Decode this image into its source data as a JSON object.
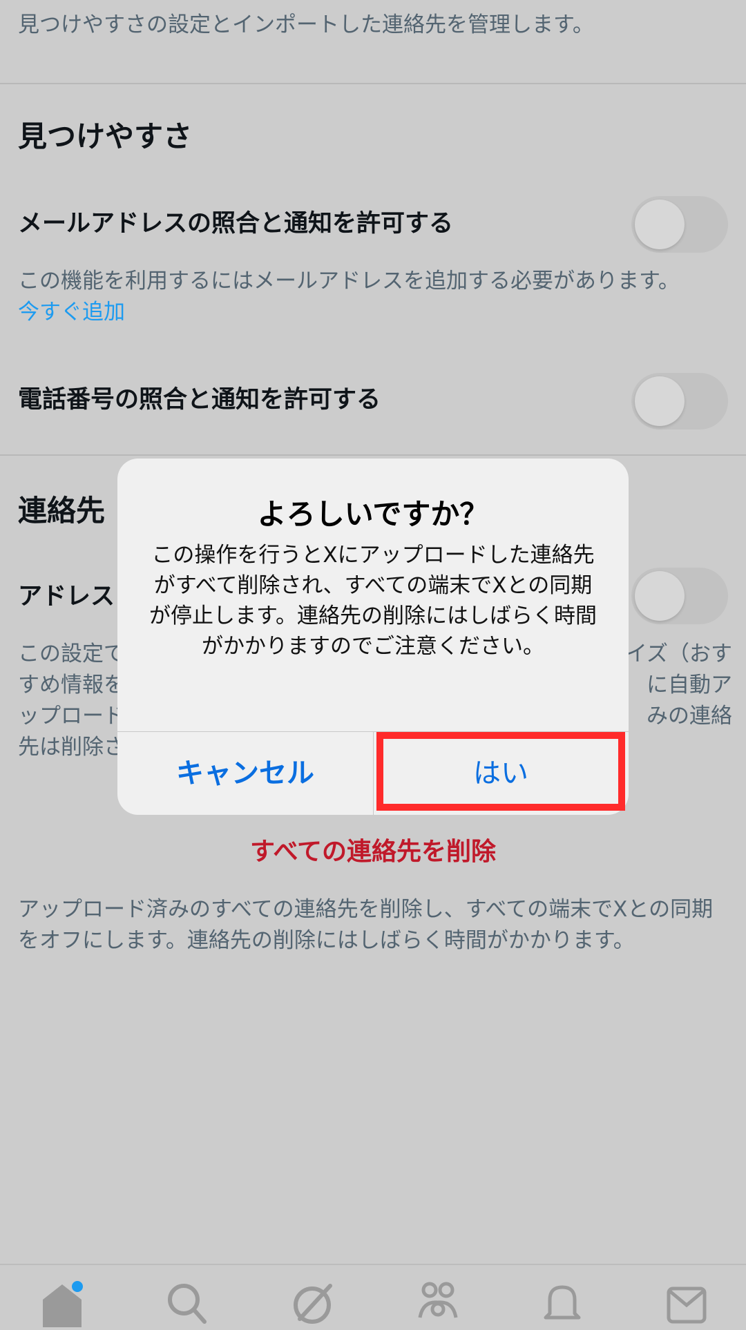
{
  "page": {
    "subtitle": "見つけやすさの設定とインポートした連絡先を管理します。",
    "discoverability": {
      "title": "見つけやすさ",
      "email_label": "メールアドレスの照合と通知を許可する",
      "email_desc": "この機能を利用するにはメールアドレスを追加する必要があります。",
      "email_link": "今すぐ追加",
      "phone_label": "電話番号の照合と通知を許可する"
    },
    "contacts": {
      "title": "連絡先",
      "sync_label": "アドレス",
      "sync_desc_line1": "この設定で",
      "sync_desc_line1_right": "イズ（おす",
      "sync_desc_line2": "すめ情報を",
      "sync_desc_line2_right": "に自動ア",
      "sync_desc_line3": "ップロード",
      "sync_desc_line3_right": "みの連絡",
      "sync_desc_line4": "先は削除さ",
      "delete_all": "すべての連絡先を削除",
      "delete_desc": "アップロード済みのすべての連絡先を削除し、すべての端末でXとの同期をオフにします。連絡先の削除にはしばらく時間がかかります。"
    }
  },
  "dialog": {
    "title": "よろしいですか？",
    "message": "この操作を行うとXにアップロードした連絡先がすべて削除され、すべての端末でXとの同期が停止します。連絡先の削除にはしばらく時間がかかりますのでご注意ください。",
    "cancel_label": "キャンセル",
    "confirm_label": "はい"
  },
  "tabbar": {
    "items": [
      "home-icon",
      "search-icon",
      "grok-icon",
      "communities-icon",
      "notifications-icon",
      "messages-icon"
    ],
    "home_has_badge": true
  },
  "colors": {
    "accent": "#1d9bf0",
    "danger": "#c0192a",
    "highlight": "#ff2b2b",
    "dialog_button": "#0a6ee0"
  }
}
